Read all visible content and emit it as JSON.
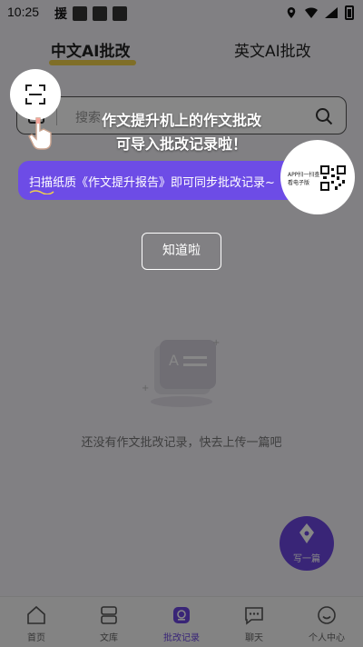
{
  "status_bar": {
    "time": "10:25",
    "icon_text": "援"
  },
  "tabs": [
    {
      "label": "中文AI批改",
      "active": true
    },
    {
      "label": "英文AI批改",
      "active": false
    }
  ],
  "search": {
    "placeholder": "搜索"
  },
  "empty_state": {
    "message": "还没有作文批改记录，快去上传一篇吧"
  },
  "fab": {
    "label": "写一篇"
  },
  "bottom_nav": [
    {
      "label": "首页",
      "icon": "home-icon"
    },
    {
      "label": "文库",
      "icon": "library-icon"
    },
    {
      "label": "批改记录",
      "icon": "record-icon",
      "active": true
    },
    {
      "label": "聊天",
      "icon": "chat-icon"
    },
    {
      "label": "个人中心",
      "icon": "profile-icon"
    }
  ],
  "guide": {
    "line1": "作文提升机上的作文批改",
    "line2": "可导入批改记录啦！",
    "tip": "扫描纸质《作文提升报告》即可同步批改记录~",
    "qr_caption": "APP扫一扫查看电子版",
    "confirm_button": "知道啦"
  },
  "colors": {
    "accent": "#6c47e0",
    "tab_underline": "#f0d04a"
  }
}
